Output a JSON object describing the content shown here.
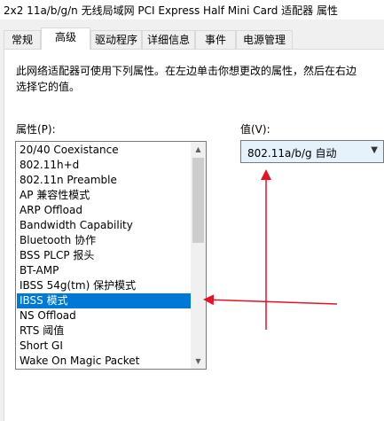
{
  "window": {
    "title": "2x2 11a/b/g/n 无线局域网 PCI Express Half Mini Card 适配器 属性"
  },
  "tabs": [
    {
      "label": "常规",
      "active": false
    },
    {
      "label": "高级",
      "active": true
    },
    {
      "label": "驱动程序",
      "active": false
    },
    {
      "label": "详细信息",
      "active": false
    },
    {
      "label": "事件",
      "active": false
    },
    {
      "label": "电源管理",
      "active": false
    }
  ],
  "advanced": {
    "description": "此网络适配器可使用下列属性。在左边单击你想更改的属性，然后在右边选择它的值。",
    "properties_label": "属性(P):",
    "value_label": "值(V):",
    "properties": [
      "20/40 Coexistance",
      "802.11h+d",
      "802.11n Preamble",
      "AP 兼容性模式",
      "ARP Offload",
      "Bandwidth Capability",
      "Bluetooth 协作",
      "BSS PLCP 报头",
      "BT-AMP",
      "IBSS 54g(tm) 保护模式",
      "IBSS 模式",
      "NS Offload",
      "RTS 阈值",
      "Short GI",
      "Wake On Magic Packet"
    ],
    "selected_index": 10,
    "value_selected": "802.11a/b/g 自动"
  },
  "icons": {
    "scroll_up": "scroll-up-arrow-icon",
    "scroll_down": "scroll-down-arrow-icon",
    "dropdown": "chevron-down-icon"
  },
  "colors": {
    "selection": "#0078d7",
    "annotation": "#e81123"
  }
}
